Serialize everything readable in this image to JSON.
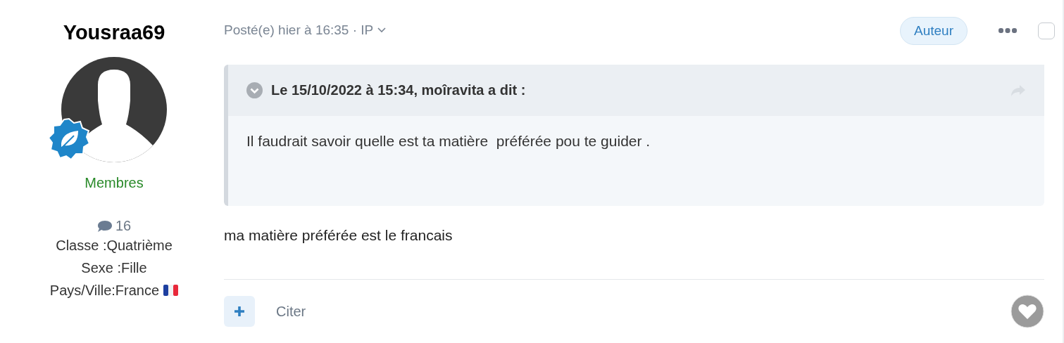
{
  "author": {
    "name": "Yousraa69",
    "group": "Membres",
    "post_count": "16",
    "fields": [
      {
        "text": "Classe :Quatrième",
        "flag": false
      },
      {
        "text": "Sexe :Fille",
        "flag": false
      },
      {
        "text": "Pays/Ville:France",
        "flag": true
      }
    ]
  },
  "post": {
    "meta": "Posté(e) hier à 16:35 · IP",
    "badge": "Auteur",
    "checked": false,
    "quote": {
      "header": "Le 15/10/2022 à 15:34, moîravita a dit :",
      "body": "Il faudrait savoir quelle est ta matière  préférée pou te guider ."
    },
    "body": "ma matière préférée est le francais",
    "quote_button": "Citer"
  }
}
